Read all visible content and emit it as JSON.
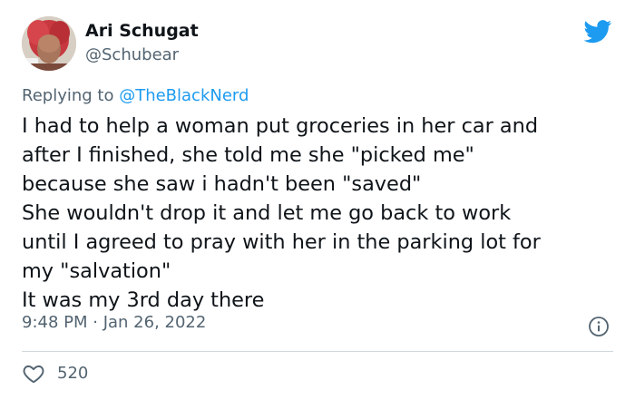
{
  "tweet": {
    "author": {
      "display_name": "Ari Schugat",
      "handle": "@Schubear",
      "avatar_icon": "profile-photo"
    },
    "reply": {
      "prefix": "Replying to ",
      "mention": "@TheBlackNerd"
    },
    "text": "I had to help a woman put groceries in her car and\nafter I finished, she told me she \"picked me\"\nbecause she saw i hadn't been \"saved\"\n She wouldn't drop it and let me go back to work\nuntil I agreed to pray with her in the parking lot for\nmy \"salvation\"\n It was my 3rd day there",
    "timestamp": "9:48 PM · Jan 26, 2022",
    "likes": "520",
    "icons": {
      "brand": "twitter-bird-icon",
      "info": "info-icon",
      "like": "heart-icon"
    }
  },
  "colors": {
    "brand_blue": "#1d9bf0",
    "primary_text": "#0f1419",
    "secondary_text": "#536471",
    "divider": "#cfd9de"
  }
}
